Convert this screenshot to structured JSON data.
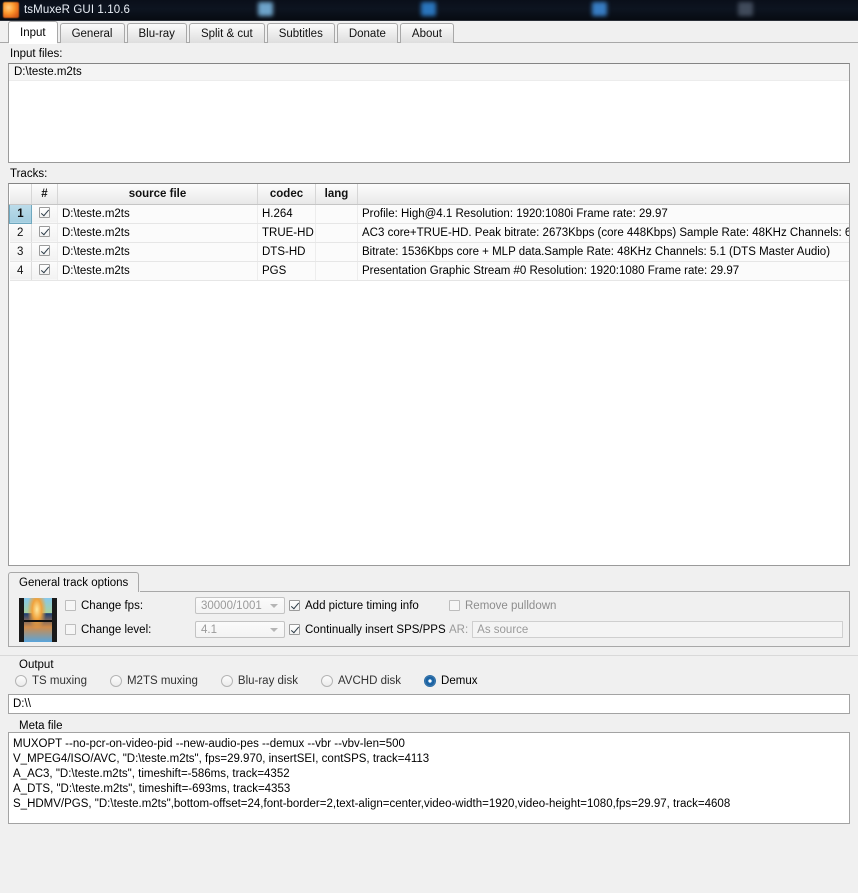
{
  "titlebar": {
    "icon": "tsmuxer-app-icon",
    "title": "tsMuxeR GUI 1.10.6"
  },
  "tabs": [
    {
      "label": "Input",
      "active": true
    },
    {
      "label": "General",
      "active": false
    },
    {
      "label": "Blu-ray",
      "active": false
    },
    {
      "label": "Split & cut",
      "active": false
    },
    {
      "label": "Subtitles",
      "active": false
    },
    {
      "label": "Donate",
      "active": false
    },
    {
      "label": "About",
      "active": false
    }
  ],
  "input_section": {
    "label": "Input files:",
    "files": [
      "D:\\teste.m2ts"
    ]
  },
  "tracks_section": {
    "label": "Tracks:",
    "columns": [
      "",
      "#",
      "source file",
      "codec",
      "lang",
      ""
    ],
    "rows": [
      {
        "index": "1",
        "checked": true,
        "selected": true,
        "source_file": "D:\\teste.m2ts",
        "codec": "H.264",
        "lang": "",
        "description": "Profile: High@4.1  Resolution: 1920:1080i  Frame rate: 29.97"
      },
      {
        "index": "2",
        "checked": true,
        "selected": false,
        "source_file": "D:\\teste.m2ts",
        "codec": "TRUE-HD",
        "lang": "",
        "description": "AC3 core+TRUE-HD. Peak bitrate: 2673Kbps (core 448Kbps) Sample Rate: 48KHz Channels: 6"
      },
      {
        "index": "3",
        "checked": true,
        "selected": false,
        "source_file": "D:\\teste.m2ts",
        "codec": "DTS-HD",
        "lang": "",
        "description": "Bitrate: 1536Kbps  core + MLP data.Sample Rate: 48KHz  Channels: 5.1 (DTS Master Audio)"
      },
      {
        "index": "4",
        "checked": true,
        "selected": false,
        "source_file": "D:\\teste.m2ts",
        "codec": "PGS",
        "lang": "",
        "description": "Presentation Graphic Stream #0 Resolution: 1920:1080 Frame rate: 29.97"
      }
    ]
  },
  "track_options": {
    "tab_label": "General track options",
    "preview_icon": "film-strip-icon",
    "change_fps": {
      "label": "Change fps:",
      "checked": false,
      "value": "30000/1001",
      "enabled": false
    },
    "change_level": {
      "label": "Change level:",
      "checked": false,
      "value": "4.1",
      "enabled": false
    },
    "add_picture_timing": {
      "label": "Add picture timing info",
      "checked": true
    },
    "continually_insert_sps_pps": {
      "label": "Continually insert SPS/PPS",
      "checked": true
    },
    "remove_pulldown": {
      "label": "Remove pulldown",
      "checked": false,
      "enabled": false
    },
    "ar": {
      "label": "AR:",
      "value": "As source",
      "enabled": false
    }
  },
  "output": {
    "title": "Output",
    "modes": [
      {
        "label": "TS muxing",
        "selected": false
      },
      {
        "label": "M2TS muxing",
        "selected": false
      },
      {
        "label": "Blu-ray disk",
        "selected": false
      },
      {
        "label": "AVCHD disk",
        "selected": false
      },
      {
        "label": "Demux",
        "selected": true
      }
    ],
    "path": "D:\\\\"
  },
  "meta_file": {
    "title": "Meta file",
    "lines": [
      "MUXOPT --no-pcr-on-video-pid --new-audio-pes --demux --vbr  --vbv-len=500",
      "V_MPEG4/ISO/AVC, \"D:\\teste.m2ts\", fps=29.970, insertSEI, contSPS, track=4113",
      "A_AC3, \"D:\\teste.m2ts\", timeshift=-586ms, track=4352",
      "A_DTS, \"D:\\teste.m2ts\", timeshift=-693ms, track=4353",
      "S_HDMV/PGS, \"D:\\teste.m2ts\",bottom-offset=24,font-border=2,text-align=center,video-width=1920,video-height=1080,fps=29.97, track=4608"
    ]
  },
  "colors": {
    "titlebar_bg": "#0a0f1a",
    "window_bg": "#f0f0f0",
    "selection_blue": "#a3cddf",
    "radio_accent": "#1f6fb4"
  }
}
